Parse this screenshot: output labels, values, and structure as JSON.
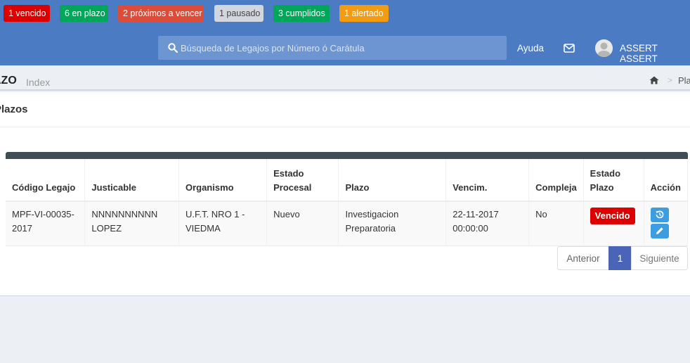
{
  "topbar": {
    "badges": [
      {
        "label": "1 vencido",
        "bg": "#dd0000",
        "fg": "#ffffff"
      },
      {
        "label": "6 en plazo",
        "bg": "#00a65a",
        "fg": "#ffffff"
      },
      {
        "label": "2 próximos a vencer",
        "bg": "#dd4b39",
        "fg": "#ffffff"
      },
      {
        "label": "1 pausado",
        "bg": "#d2d6de",
        "fg": "#444444"
      },
      {
        "label": "3 cumplidos",
        "bg": "#00a65a",
        "fg": "#ffffff"
      },
      {
        "label": "1 alertado",
        "bg": "#f39c12",
        "fg": "#ffffff"
      }
    ],
    "search": {
      "placeholder": "Búsqueda de Legajos por Número ó Carátula",
      "icon": "search-icon"
    },
    "help_label": "Ayuda",
    "mail_icon": "envelope-icon",
    "user_name": "ASSERT ASSERT"
  },
  "header": {
    "title": "azo",
    "subtitle": "Index",
    "breadcrumb": {
      "home_icon": "home-icon",
      "separator": ">",
      "current": "Pla"
    }
  },
  "panel": {
    "title": "Plazos",
    "columns": [
      "Código Legajo",
      "Justicable",
      "Organismo",
      "Estado Procesal",
      "Plazo",
      "Vencim.",
      "Compleja",
      "Estado Plazo",
      "Acción"
    ],
    "rows": [
      {
        "codigo": "MPF-VI-00035-2017",
        "justicable": "NNNNNNNNNN LOPEZ",
        "organismo": "U.F.T. NRO 1 - VIEDMA",
        "estado_procesal": "Nuevo",
        "plazo": "Investigacion Preparatoria",
        "vencim": "22-11-2017 00:00:00",
        "compleja": "No",
        "estado_plazo": "Vencido",
        "actions": [
          "history-icon",
          "pencil-icon"
        ]
      }
    ],
    "pagination": {
      "prev": "Anterior",
      "current": "1",
      "next": "Siguiente"
    }
  },
  "colors": {
    "topbar": "#4a7bc3",
    "status_vencido": "#dd0000",
    "action_button": "#3c9ee0",
    "active_page": "#4a64b8"
  }
}
